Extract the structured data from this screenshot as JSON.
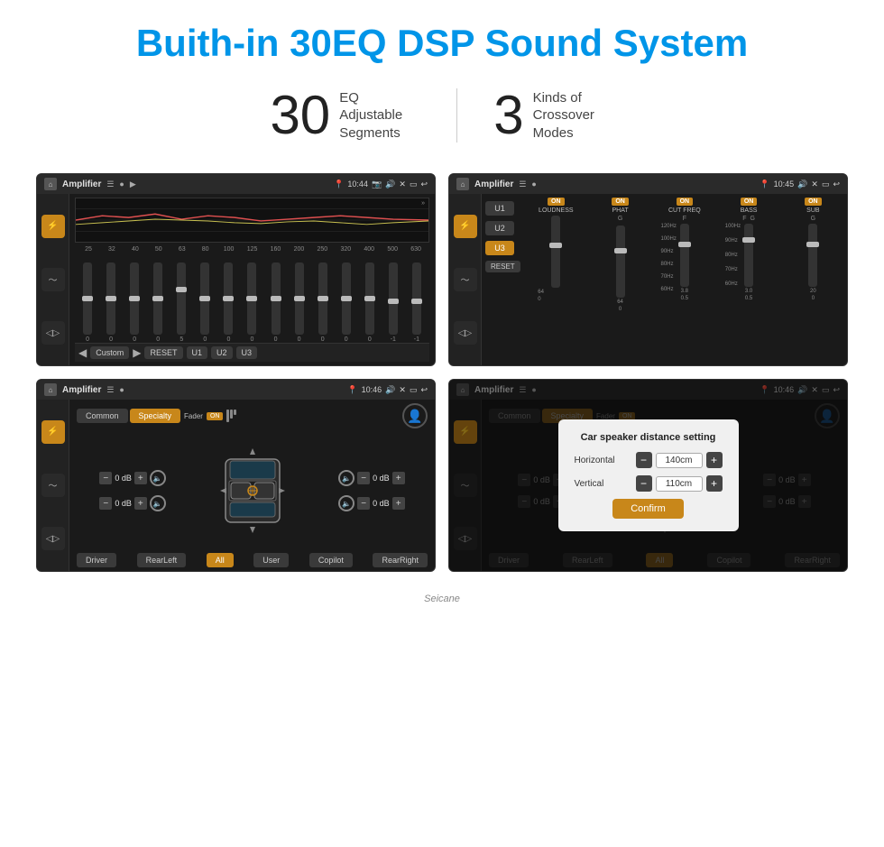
{
  "header": {
    "title": "Buith-in 30EQ DSP Sound System"
  },
  "stats": {
    "eq_number": "30",
    "eq_label_line1": "EQ Adjustable",
    "eq_label_line2": "Segments",
    "crossover_number": "3",
    "crossover_label_line1": "Kinds of",
    "crossover_label_line2": "Crossover Modes"
  },
  "screens": [
    {
      "id": "eq-screen",
      "amp_label": "Amplifier",
      "time": "10:44",
      "freqs": [
        "25",
        "32",
        "40",
        "50",
        "63",
        "80",
        "100",
        "125",
        "160",
        "200",
        "250",
        "320",
        "400",
        "500",
        "630"
      ],
      "values": [
        "0",
        "0",
        "0",
        "0",
        "5",
        "0",
        "0",
        "0",
        "0",
        "0",
        "0",
        "0",
        "0",
        "-1",
        "0",
        "-1"
      ],
      "preset": "Custom",
      "bottom_buttons": [
        "RESET",
        "U1",
        "U2",
        "U3"
      ]
    },
    {
      "id": "crossover-screen",
      "amp_label": "Amplifier",
      "time": "10:45",
      "channels": [
        "LOUDNESS",
        "PHAT",
        "CUT FREQ",
        "BASS",
        "SUB"
      ],
      "u_buttons": [
        "U1",
        "U2",
        "U3"
      ],
      "active_u": "U3",
      "reset_label": "RESET"
    },
    {
      "id": "specialty-screen",
      "amp_label": "Amplifier",
      "time": "10:46",
      "tabs": [
        "Common",
        "Specialty"
      ],
      "fader_label": "Fader",
      "fader_on": "ON",
      "speakers": {
        "front_left_db": "0 dB",
        "front_right_db": "0 dB",
        "rear_left_db": "0 dB",
        "rear_right_db": "0 dB"
      },
      "bottom_labels": [
        "Driver",
        "RearLeft",
        "All",
        "User",
        "Copilot",
        "RearRight"
      ]
    },
    {
      "id": "dialog-screen",
      "amp_label": "Amplifier",
      "time": "10:46",
      "tabs": [
        "Common",
        "Specialty"
      ],
      "dialog": {
        "title": "Car speaker distance setting",
        "horizontal_label": "Horizontal",
        "horizontal_value": "140cm",
        "vertical_label": "Vertical",
        "vertical_value": "110cm",
        "confirm_label": "Confirm"
      },
      "bottom_labels": [
        "Driver",
        "RearLeft",
        "All",
        "Copilot",
        "RearRight"
      ]
    }
  ],
  "watermark": "Seicane"
}
